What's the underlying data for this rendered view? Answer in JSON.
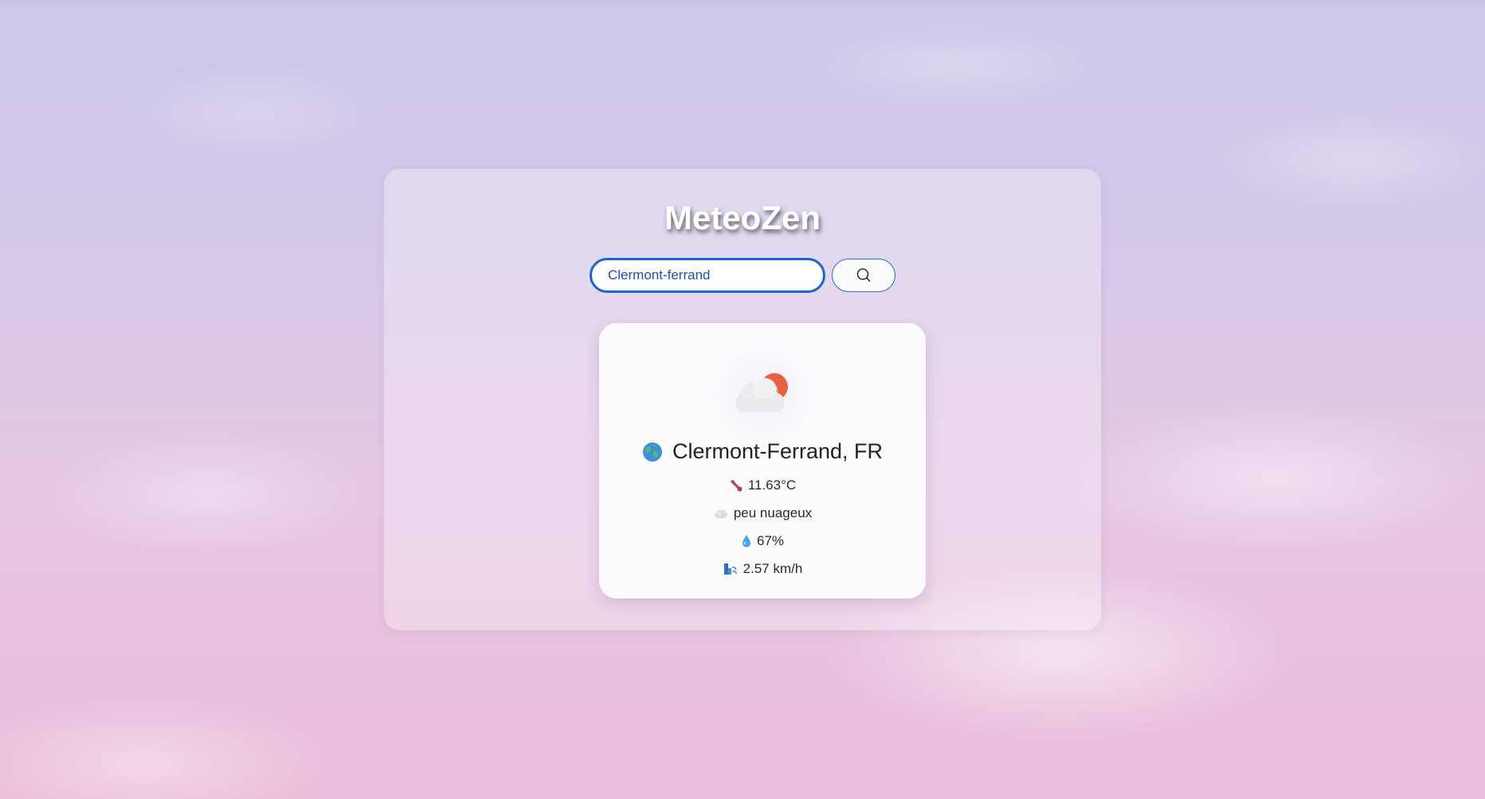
{
  "app": {
    "title": "MeteoZen"
  },
  "search": {
    "value": "Clermont-ferrand",
    "button_icon": "search-icon"
  },
  "weather": {
    "condition_icon": "cloud-sun-icon",
    "location_icon": "globe-icon",
    "location": "Clermont-Ferrand, FR",
    "temperature_icon": "thermometer-icon",
    "temperature": "11.63°C",
    "description_icon": "cloud-icon",
    "description": "peu nuageux",
    "humidity_icon": "droplet-icon",
    "humidity": "67%",
    "wind_icon": "wind-icon",
    "wind": "2.57 km/h"
  },
  "colors": {
    "accent": "#1a63d6",
    "sun": "#e8613c"
  }
}
